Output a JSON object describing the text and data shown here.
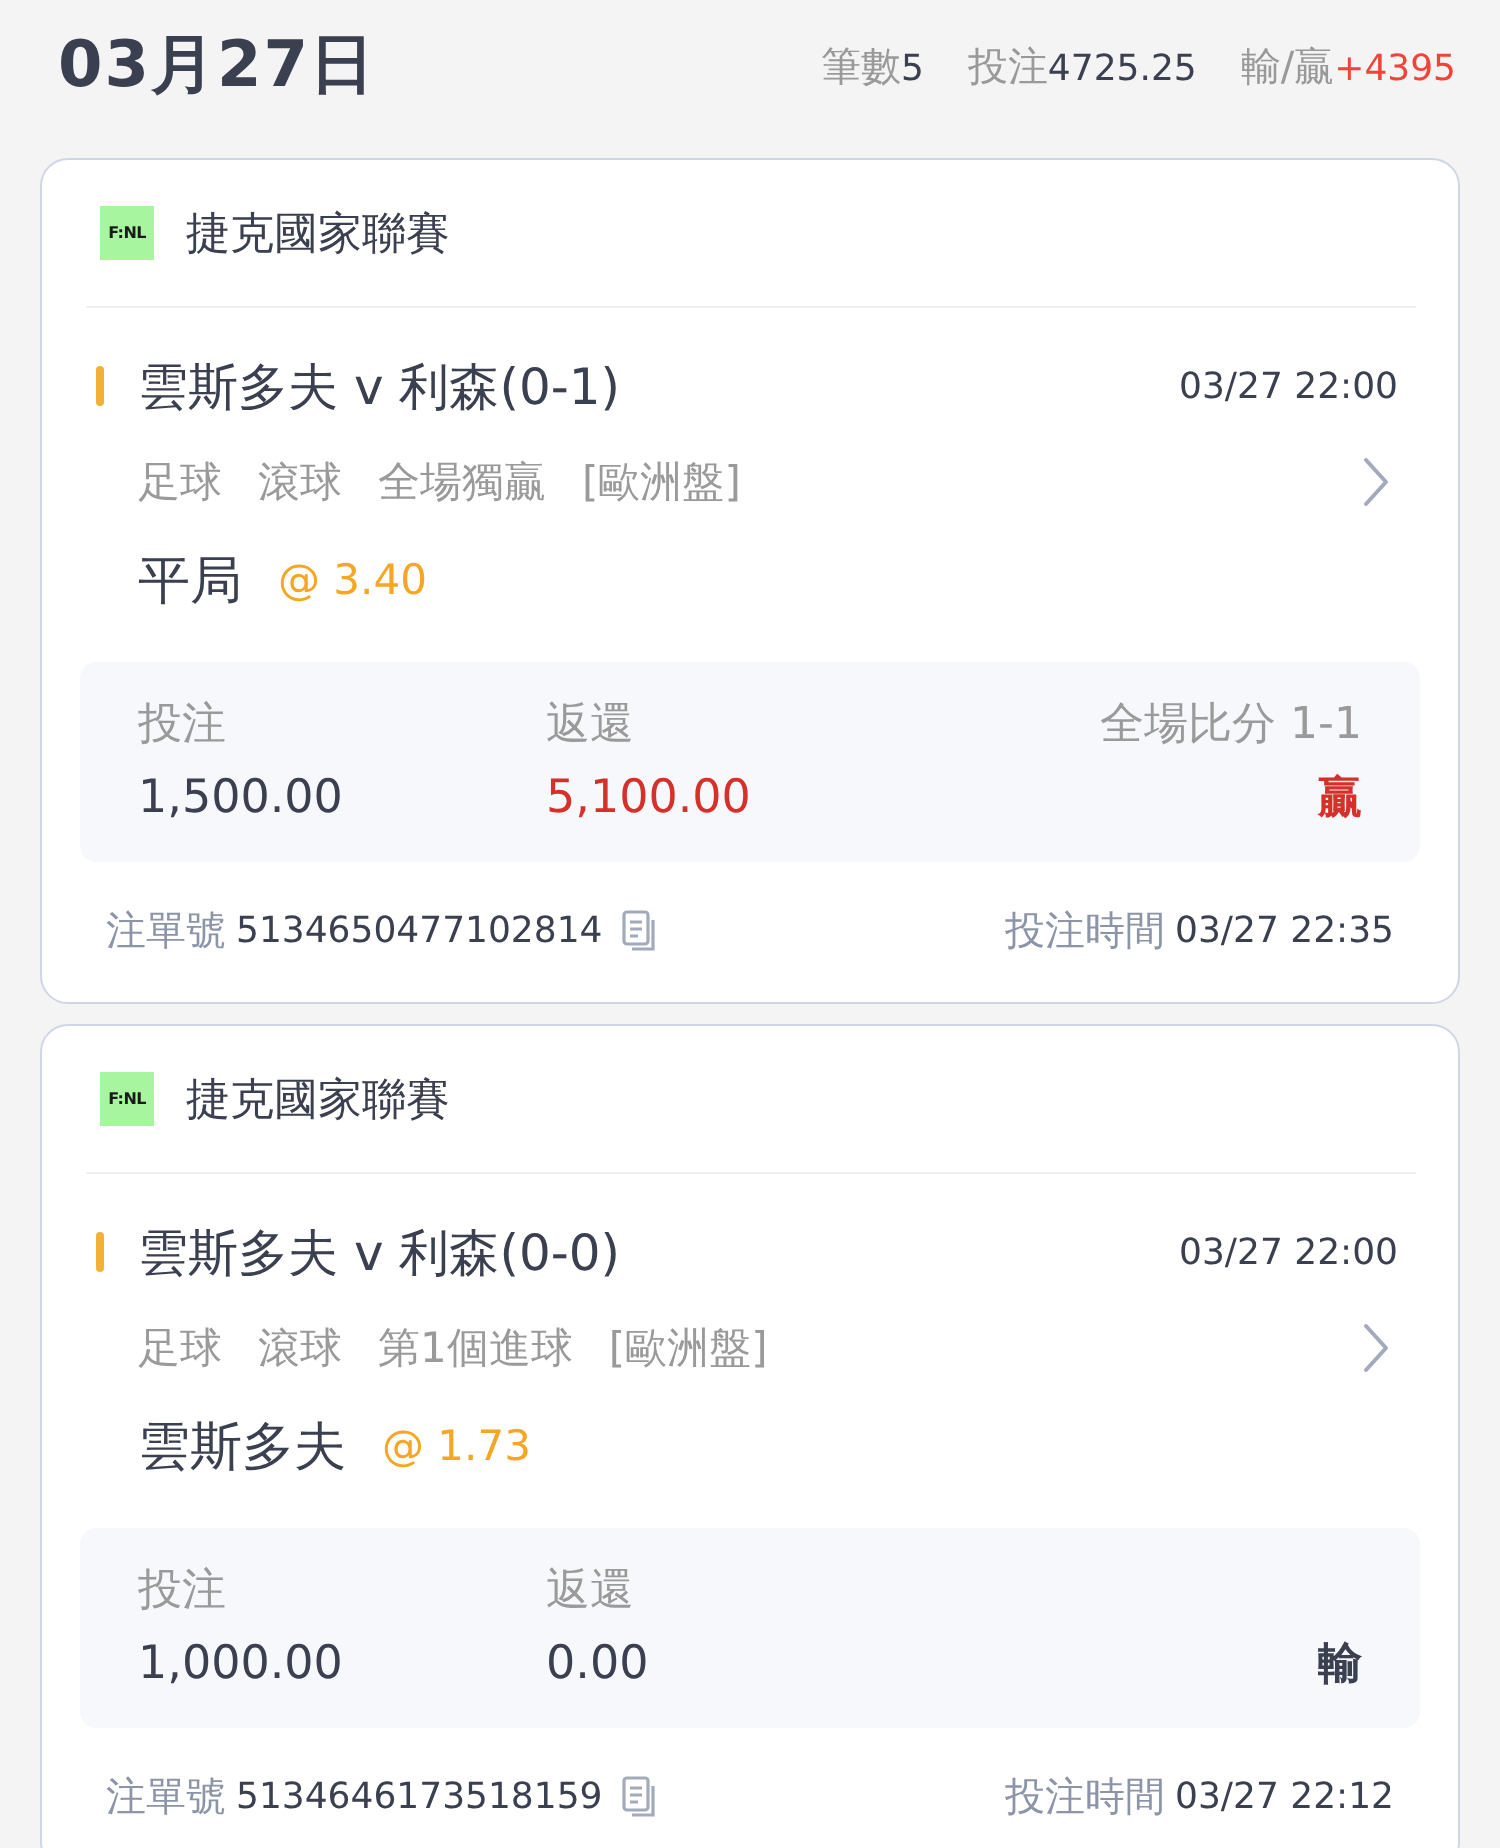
{
  "header": {
    "date": "03月27日",
    "count_label": "筆數",
    "count": "5",
    "stake_label": "投注",
    "stake": "4725.25",
    "result_label": "輸/贏",
    "result": "+4395"
  },
  "bets": [
    {
      "league_logo": "F:NL",
      "league": "捷克國家聯賽",
      "match": "雲斯多夫 v 利森(0-1)",
      "kickoff": "03/27 22:00",
      "tags": [
        "足球",
        "滾球",
        "全場獨贏",
        "[歐洲盤]"
      ],
      "pick": "平局",
      "odds": "@ 3.40",
      "stake_label": "投注",
      "stake": "1,500.00",
      "return_label": "返還",
      "return": "5,100.00",
      "score": "全場比分 1-1",
      "outcome": {
        "text": "贏",
        "kind": "win"
      },
      "ticket_label": "注單號",
      "ticket": "5134650477102814",
      "time_label": "投注時間",
      "time": "03/27 22:35"
    },
    {
      "league_logo": "F:NL",
      "league": "捷克國家聯賽",
      "match": "雲斯多夫 v 利森(0-0)",
      "kickoff": "03/27 22:00",
      "tags": [
        "足球",
        "滾球",
        "第1個進球",
        "[歐洲盤]"
      ],
      "pick": "雲斯多夫",
      "odds": "@ 1.73",
      "stake_label": "投注",
      "stake": "1,000.00",
      "return_label": "返還",
      "return": "0.00",
      "outcome": {
        "text": "輸",
        "kind": "lose"
      },
      "ticket_label": "注單號",
      "ticket": "5134646173518159",
      "time_label": "投注時間",
      "time": "03/27 22:12"
    }
  ]
}
